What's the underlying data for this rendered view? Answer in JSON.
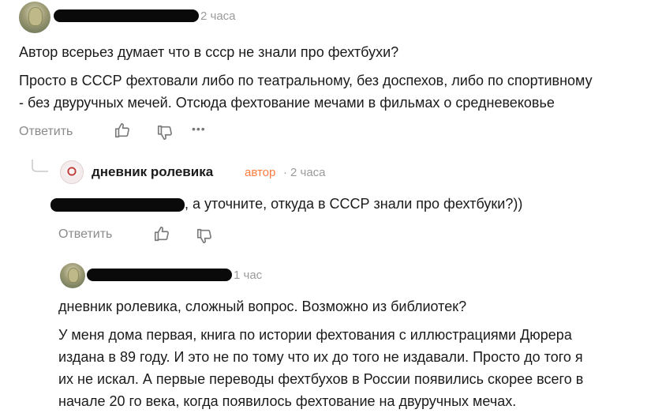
{
  "comments": [
    {
      "time": "2 часа",
      "paragraphs": [
        "Автор всерьез думает что в ссср не знали про фехтбухи?",
        "Просто в СССР фехтовали либо по театральному, без доспехов, либо по спортивному",
        "- без двуручных мечей. Отсюда фехтование мечами в фильмах о средневековье"
      ],
      "reply_label": "Ответить",
      "more_label": "•••"
    },
    {
      "author": "дневник ролевика",
      "author_tag": "автор",
      "separator": "·",
      "time": "2 часа",
      "text_suffix": ", а уточните, откуда в СССР знали про фехтбуки?))",
      "reply_label": "Ответить"
    },
    {
      "time": "1 час",
      "paragraphs": [
        "дневник ролевика, сложный вопрос. Возможно из библиотек?",
        "У меня дома первая, книга по истории фехтования с иллюстрациями Дюрера",
        "издана в 89 году. И это не по тому что их до того не издавали. Просто до того я",
        "их не искал. А первые переводы фехтбухов в России появились скорее всего в",
        "начале 20 го века, когда появилось фехтование на двуручных мечах."
      ]
    }
  ],
  "colors": {
    "author_tag": "#ff7a3d",
    "muted": "#8a8a8a",
    "redaction": "#0a0a0a"
  },
  "icons": [
    "like-icon",
    "dislike-icon",
    "more-icon",
    "thread-line-icon"
  ]
}
